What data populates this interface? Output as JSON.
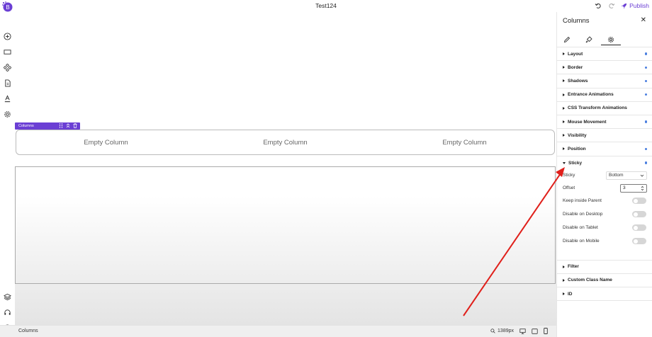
{
  "app": {
    "title": "Test124"
  },
  "toolbar": {
    "publish_label": "Publish"
  },
  "canvas": {
    "selection_label": "Columns",
    "columns": [
      "Empty Column",
      "Empty Column",
      "Empty Column"
    ]
  },
  "status": {
    "element_label": "Columns",
    "zoom": "1389px"
  },
  "panel": {
    "title": "Columns",
    "sections": [
      {
        "label": "Layout",
        "modified": true
      },
      {
        "label": "Border",
        "modified": true
      },
      {
        "label": "Shadows",
        "modified": true
      },
      {
        "label": "Entrance Animations",
        "modified": true
      },
      {
        "label": "CSS Transform Animations",
        "modified": false
      },
      {
        "label": "Mouse Movement",
        "modified": true
      },
      {
        "label": "Visibility",
        "modified": false
      },
      {
        "label": "Position",
        "modified": true
      },
      {
        "label": "Sticky",
        "modified": true
      }
    ],
    "sticky": {
      "sticky_label": "Sticky",
      "sticky_value": "Bottom",
      "offset_label": "Offset",
      "offset_value": "3",
      "keep_inside_parent": "Keep inside Parent",
      "disable_desktop": "Disable on Desktop",
      "disable_tablet": "Disable on Tablet",
      "disable_mobile": "Disable on Mobile"
    },
    "sections_after": [
      {
        "label": "Filter"
      },
      {
        "label": "Custom Class Name"
      },
      {
        "label": "ID"
      }
    ]
  },
  "colors": {
    "accent": "#6b3fd4",
    "dot": "#4a7fe0",
    "arrow": "#e0201b"
  }
}
